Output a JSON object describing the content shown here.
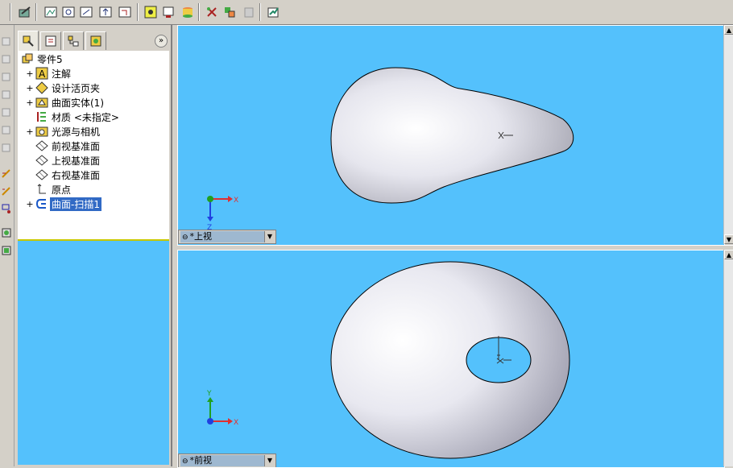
{
  "tree": {
    "root": "零件5",
    "items": [
      {
        "label": "注解",
        "icon": "annotations-icon",
        "expandable": true
      },
      {
        "label": "设计活页夹",
        "icon": "design-binder-icon",
        "expandable": true
      },
      {
        "label": "曲面实体(1)",
        "icon": "surface-bodies-folder-icon",
        "expandable": true
      },
      {
        "label": "材质 <未指定>",
        "icon": "material-icon",
        "expandable": false
      },
      {
        "label": "光源与相机",
        "icon": "lights-cameras-icon",
        "expandable": true
      },
      {
        "label": "前视基准面",
        "icon": "plane-icon",
        "expandable": false
      },
      {
        "label": "上视基准面",
        "icon": "plane-icon",
        "expandable": false
      },
      {
        "label": "右视基准面",
        "icon": "plane-icon",
        "expandable": false
      },
      {
        "label": "原点",
        "icon": "origin-icon",
        "expandable": false
      },
      {
        "label": "曲面-扫描1",
        "icon": "surface-sweep-icon",
        "expandable": true,
        "selected": true
      }
    ]
  },
  "panel": {
    "expand_symbol": "»"
  },
  "views": {
    "top": {
      "name": "*上视",
      "triad_axes": [
        "X",
        "Z"
      ]
    },
    "front": {
      "name": "*前视",
      "triad_axes": [
        "X",
        "Y"
      ]
    }
  },
  "colors": {
    "viewport_bg": "#54c1fc",
    "selection": "#316ac5",
    "axis_x": "#e03030",
    "axis_y": "#20a020",
    "axis_z": "#2040e0"
  }
}
